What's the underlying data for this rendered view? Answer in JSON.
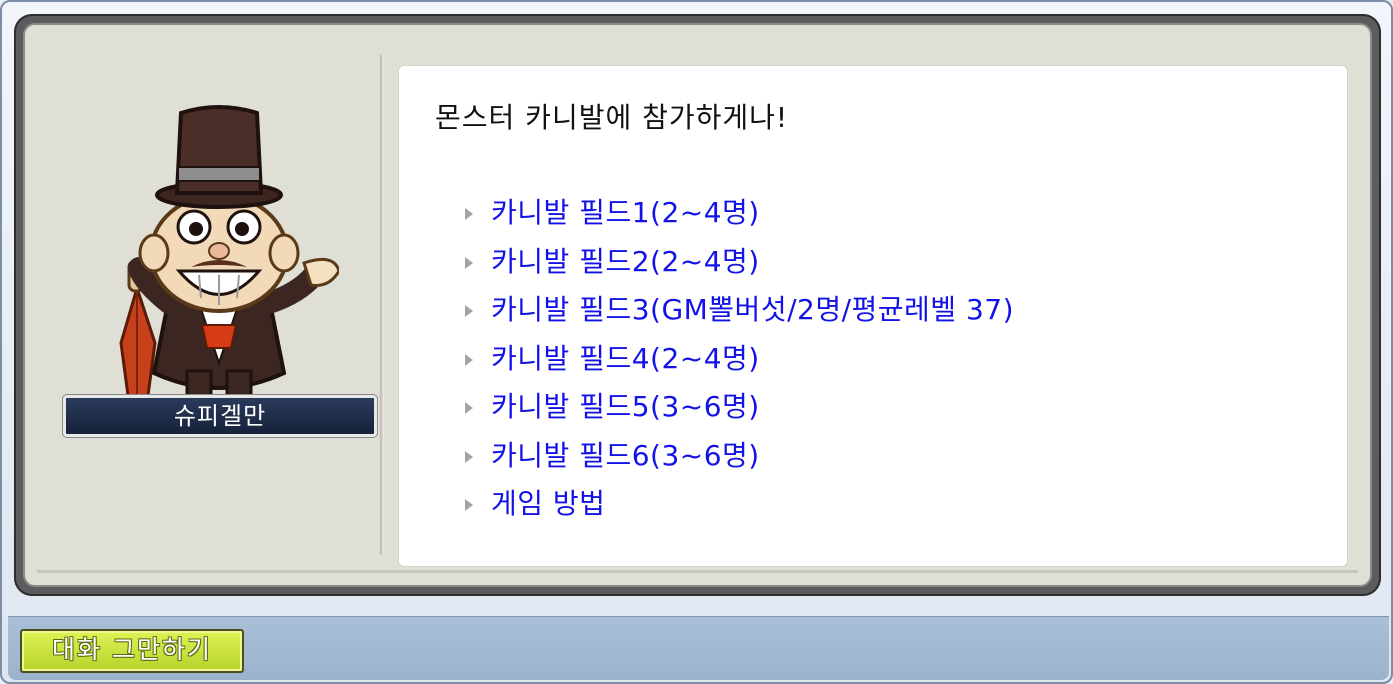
{
  "npc": {
    "name": "슈피겔만"
  },
  "dialog": {
    "text": "몬스터 카니발에 참가하게나!",
    "options": [
      {
        "label": "카니발 필드1(2~4명)"
      },
      {
        "label": "카니발 필드2(2~4명)"
      },
      {
        "label": "카니발 필드3(GM뽈버섯/2명/평균레벨 37)"
      },
      {
        "label": "카니발 필드4(2~4명)"
      },
      {
        "label": "카니발 필드5(3~6명)"
      },
      {
        "label": "카니발 필드6(3~6명)"
      },
      {
        "label": "게임 방법"
      }
    ]
  },
  "footer": {
    "end_chat_label": "대화 그만하기"
  }
}
